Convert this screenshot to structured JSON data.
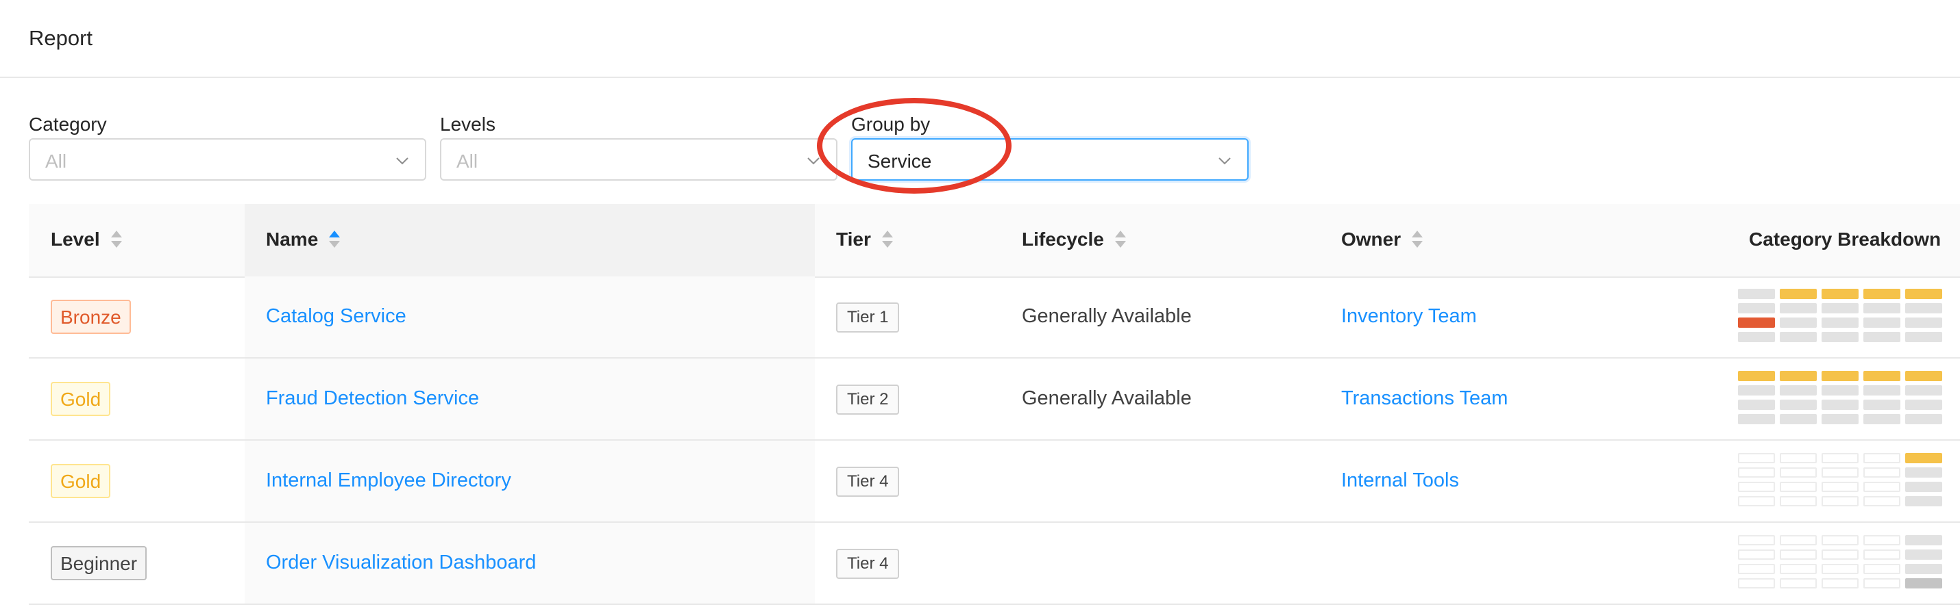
{
  "header": {
    "title": "Report"
  },
  "filters": {
    "category": {
      "label": "Category",
      "value": "All"
    },
    "levels": {
      "label": "Levels",
      "value": "All"
    },
    "group_by": {
      "label": "Group by",
      "value": "Service"
    }
  },
  "table": {
    "columns": {
      "level": "Level",
      "name": "Name",
      "tier": "Tier",
      "lifecycle": "Lifecycle",
      "owner": "Owner",
      "breakdown": "Category Breakdown"
    },
    "rows": [
      {
        "level": "Bronze",
        "name": "Catalog Service",
        "tier": "Tier 1",
        "lifecycle": "Generally Available",
        "owner": "Inventory Team"
      },
      {
        "level": "Gold",
        "name": "Fraud Detection Service",
        "tier": "Tier 2",
        "lifecycle": "Generally Available",
        "owner": "Transactions Team"
      },
      {
        "level": "Gold",
        "name": "Internal Employee Directory",
        "tier": "Tier 4",
        "lifecycle": "",
        "owner": "Internal Tools"
      },
      {
        "level": "Beginner",
        "name": "Order Visualization Dashboard",
        "tier": "Tier 4",
        "lifecycle": "",
        "owner": ""
      }
    ]
  },
  "colors": {
    "link": "#1890ff",
    "bronze": "#e05a2b",
    "gold": "#f0a818",
    "breakdown_passed": "#f5c24a",
    "breakdown_failed": "#e35a33",
    "breakdown_pending": "#e2e2e2",
    "highlight": "#e53a2a"
  }
}
